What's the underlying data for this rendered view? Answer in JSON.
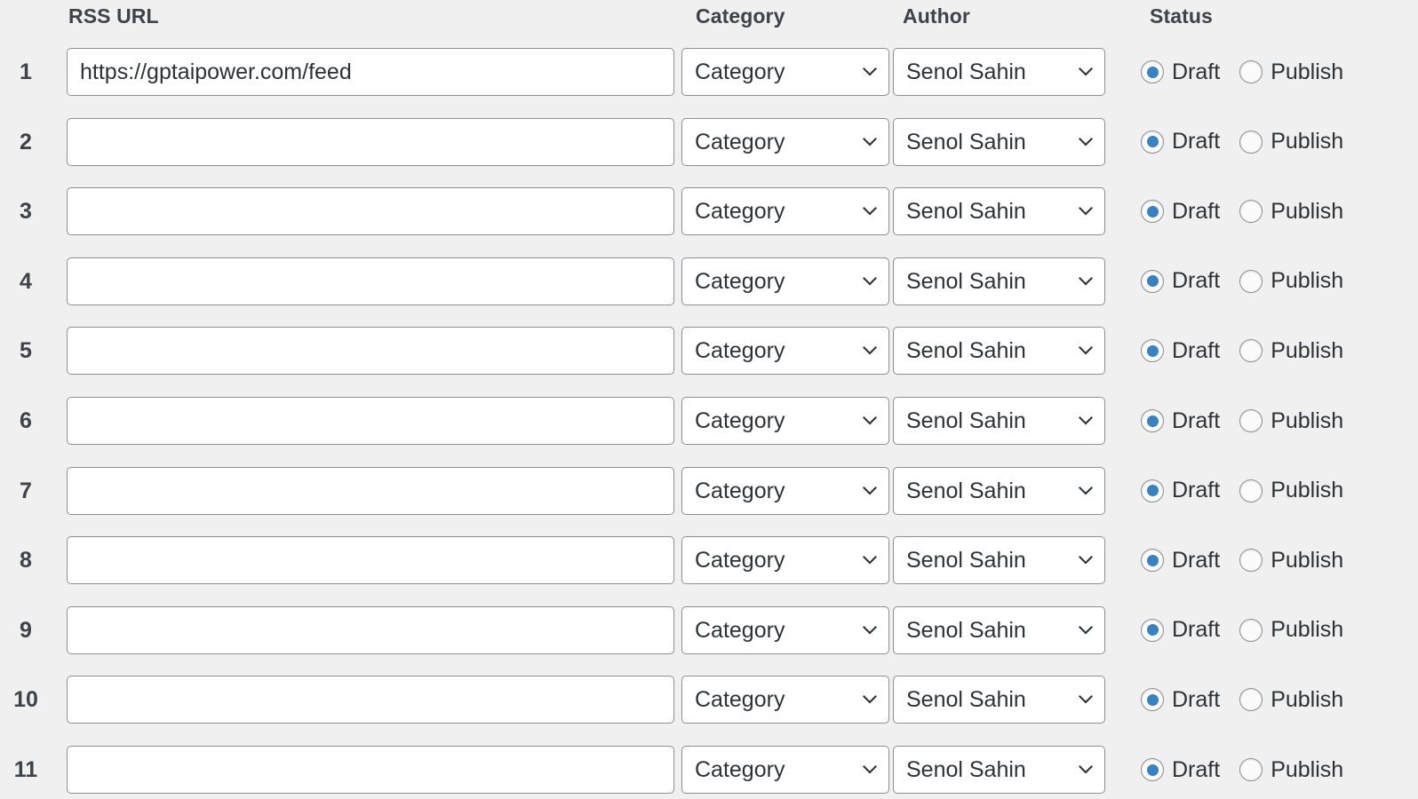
{
  "table": {
    "columns": {
      "rss_url": "RSS URL",
      "category": "Category",
      "author": "Author",
      "status": "Status"
    },
    "status_options": {
      "draft": "Draft",
      "publish": "Publish"
    },
    "icons": {
      "select_chevron": "chevron-down-icon"
    },
    "colors": {
      "background": "#f0f0f1",
      "field_background": "#ffffff",
      "border": "#8c8f94",
      "text": "#2c3338",
      "heading": "#3c434a",
      "accent_radio": "#3582c4"
    },
    "rows": [
      {
        "index": "1",
        "url": "https://gptaipower.com/feed",
        "url_placeholder": "",
        "category": "Category",
        "author": "Senol Sahin",
        "status": "draft"
      },
      {
        "index": "2",
        "url": "",
        "url_placeholder": "",
        "category": "Category",
        "author": "Senol Sahin",
        "status": "draft"
      },
      {
        "index": "3",
        "url": "",
        "url_placeholder": "",
        "category": "Category",
        "author": "Senol Sahin",
        "status": "draft"
      },
      {
        "index": "4",
        "url": "",
        "url_placeholder": "",
        "category": "Category",
        "author": "Senol Sahin",
        "status": "draft"
      },
      {
        "index": "5",
        "url": "",
        "url_placeholder": "",
        "category": "Category",
        "author": "Senol Sahin",
        "status": "draft"
      },
      {
        "index": "6",
        "url": "",
        "url_placeholder": "",
        "category": "Category",
        "author": "Senol Sahin",
        "status": "draft"
      },
      {
        "index": "7",
        "url": "",
        "url_placeholder": "",
        "category": "Category",
        "author": "Senol Sahin",
        "status": "draft"
      },
      {
        "index": "8",
        "url": "",
        "url_placeholder": "",
        "category": "Category",
        "author": "Senol Sahin",
        "status": "draft"
      },
      {
        "index": "9",
        "url": "",
        "url_placeholder": "",
        "category": "Category",
        "author": "Senol Sahin",
        "status": "draft"
      },
      {
        "index": "10",
        "url": "",
        "url_placeholder": "",
        "category": "Category",
        "author": "Senol Sahin",
        "status": "draft"
      },
      {
        "index": "11",
        "url": "",
        "url_placeholder": "",
        "category": "Category",
        "author": "Senol Sahin",
        "status": "draft"
      }
    ]
  }
}
